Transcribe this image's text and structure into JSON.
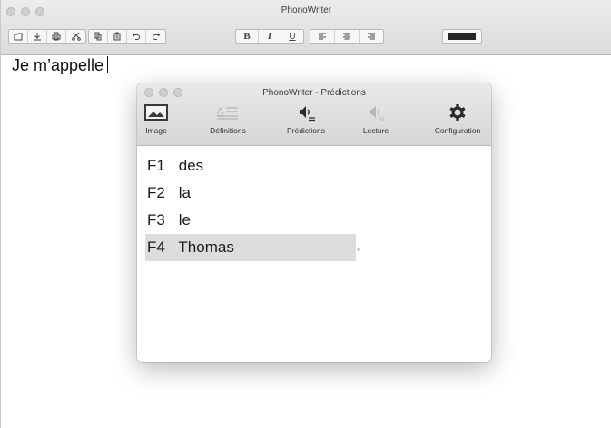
{
  "main_window": {
    "title": "PhonoWriter",
    "document_text": "Je m’appelle",
    "toolbar": {
      "buttons": [
        {
          "name": "new-document-icon",
          "glyph": ""
        },
        {
          "name": "save-icon",
          "glyph": ""
        },
        {
          "name": "print-icon",
          "glyph": ""
        },
        {
          "name": "cut-icon",
          "glyph": ""
        },
        {
          "name": "copy-icon",
          "glyph": ""
        },
        {
          "name": "paste-icon",
          "glyph": ""
        },
        {
          "name": "undo-icon",
          "glyph": ""
        },
        {
          "name": "redo-icon",
          "glyph": ""
        }
      ],
      "format": {
        "bold": "B",
        "italic": "I",
        "underline": "U"
      },
      "text_color": "#262626"
    }
  },
  "predictions_window": {
    "title": "PhonoWriter - Prédictions",
    "tabs": [
      {
        "label": "Image",
        "icon": "image-icon"
      },
      {
        "label": "Définitions",
        "icon": "definitions-icon"
      },
      {
        "label": "Prédictions",
        "icon": "speaker-predictions-icon"
      },
      {
        "label": "Lecture",
        "icon": "speaker-reading-icon"
      },
      {
        "label": "Configuration",
        "icon": "gear-icon"
      }
    ],
    "predictions": [
      {
        "key": "F1",
        "word": "des",
        "selected": false
      },
      {
        "key": "F2",
        "word": "la",
        "selected": false
      },
      {
        "key": "F3",
        "word": "le",
        "selected": false
      },
      {
        "key": "F4",
        "word": "Thomas",
        "selected": true
      }
    ]
  }
}
